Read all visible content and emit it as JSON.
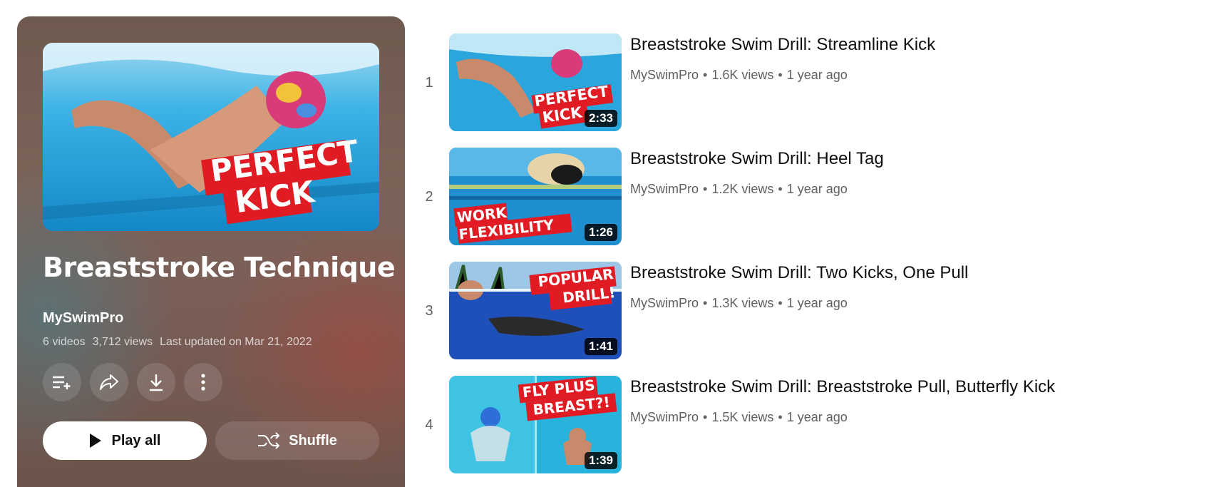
{
  "playlist": {
    "title": "Breaststroke Technique",
    "channel": "MySwimPro",
    "video_count": "6 videos",
    "views": "3,712 views",
    "last_updated": "Last updated on Mar 21, 2022",
    "hero_overlay_line1": "PERFECT",
    "hero_overlay_line2": "KICK"
  },
  "actions": {
    "icons": [
      "save-to-playlist-icon",
      "share-icon",
      "download-icon",
      "more-options-icon"
    ],
    "play_all_label": "Play all",
    "shuffle_label": "Shuffle"
  },
  "videos": [
    {
      "index": "1",
      "title": "Breaststroke Swim Drill: Streamline Kick",
      "channel": "MySwimPro",
      "views": "1.6K views",
      "age": "1 year ago",
      "duration": "2:33",
      "overlay_line1": "PERFECT",
      "overlay_line2": "KICK"
    },
    {
      "index": "2",
      "title": "Breaststroke Swim Drill: Heel Tag",
      "channel": "MySwimPro",
      "views": "1.2K views",
      "age": "1 year ago",
      "duration": "1:26",
      "overlay_line1": "WORK",
      "overlay_line2": "FLEXIBILITY"
    },
    {
      "index": "3",
      "title": "Breaststroke Swim Drill: Two Kicks, One Pull",
      "channel": "MySwimPro",
      "views": "1.3K views",
      "age": "1 year ago",
      "duration": "1:41",
      "overlay_line1": "POPULAR",
      "overlay_line2": "DRILL!"
    },
    {
      "index": "4",
      "title": "Breaststroke Swim Drill: Breaststroke Pull, Butterfly Kick",
      "channel": "MySwimPro",
      "views": "1.5K views",
      "age": "1 year ago",
      "duration": "1:39",
      "overlay_line1": "FLY PLUS",
      "overlay_line2": "BREAST?!"
    }
  ],
  "colors": {
    "accent_red": "#e01b24",
    "water_blue": "#2aa6dc",
    "panel_brown": "#7a5e57",
    "meta_gray": "#606060"
  }
}
